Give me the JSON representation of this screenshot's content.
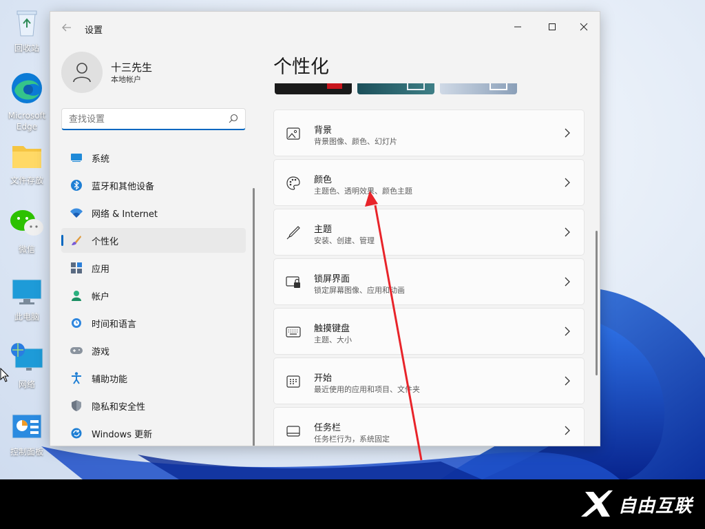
{
  "desktop": {
    "icons": [
      {
        "label": "回收站",
        "icon": "recycle-bin-icon"
      },
      {
        "label": "Microsoft Edge",
        "icon": "edge-icon"
      },
      {
        "label": "文件存放",
        "icon": "folder-icon"
      },
      {
        "label": "微信",
        "icon": "wechat-icon"
      },
      {
        "label": "此电脑",
        "icon": "computer-icon"
      },
      {
        "label": "网络",
        "icon": "network-icon"
      },
      {
        "label": "控制面板",
        "icon": "control-panel-icon"
      }
    ]
  },
  "window": {
    "title": "设置",
    "controls": [
      "minimize",
      "maximize",
      "close"
    ]
  },
  "user": {
    "name": "十三先生",
    "account_type": "本地帐户"
  },
  "search": {
    "placeholder": "查找设置"
  },
  "sidebar": {
    "items": [
      {
        "label": "系统",
        "icon": "system-icon"
      },
      {
        "label": "蓝牙和其他设备",
        "icon": "bluetooth-icon"
      },
      {
        "label": "网络 & Internet",
        "icon": "wifi-icon"
      },
      {
        "label": "个性化",
        "icon": "brush-icon",
        "active": true
      },
      {
        "label": "应用",
        "icon": "apps-icon"
      },
      {
        "label": "帐户",
        "icon": "account-icon"
      },
      {
        "label": "时间和语言",
        "icon": "globe-clock-icon"
      },
      {
        "label": "游戏",
        "icon": "gamepad-icon"
      },
      {
        "label": "辅助功能",
        "icon": "accessibility-icon"
      },
      {
        "label": "隐私和安全性",
        "icon": "shield-icon"
      },
      {
        "label": "Windows 更新",
        "icon": "update-icon"
      }
    ]
  },
  "main": {
    "title": "个性化",
    "cards": [
      {
        "title": "背景",
        "subtitle": "背景图像、颜色、幻灯片",
        "icon": "image-icon"
      },
      {
        "title": "颜色",
        "subtitle": "主题色、透明效果、颜色主题",
        "icon": "palette-icon"
      },
      {
        "title": "主题",
        "subtitle": "安装、创建、管理",
        "icon": "pen-icon"
      },
      {
        "title": "锁屏界面",
        "subtitle": "锁定屏幕图像、应用和动画",
        "icon": "lock-screen-icon"
      },
      {
        "title": "触摸键盘",
        "subtitle": "主题、大小",
        "icon": "keyboard-icon"
      },
      {
        "title": "开始",
        "subtitle": "最近使用的应用和项目、文件夹",
        "icon": "start-icon"
      },
      {
        "title": "任务栏",
        "subtitle": "任务栏行为，系统固定",
        "icon": "taskbar-icon"
      }
    ]
  },
  "watermark": {
    "text": "自由互联"
  },
  "colors": {
    "accent": "#0067c0",
    "annotation": "#e8242a"
  }
}
